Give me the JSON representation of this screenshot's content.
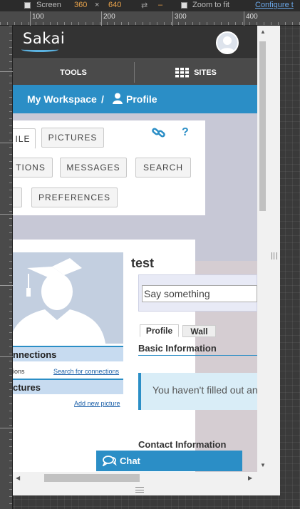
{
  "devtools": {
    "screen_label": "Screen",
    "screen_width": "360",
    "times": "×",
    "screen_height": "640",
    "dash": "–",
    "zoom_label": "Zoom to fit",
    "configure_label": "Configure t"
  },
  "ruler": {
    "ticks": [
      "100",
      "200",
      "300",
      "400"
    ]
  },
  "header": {
    "logo": "Sakai"
  },
  "toolbar": {
    "tools": "TOOLS",
    "sites": "SITES"
  },
  "breadcrumb": {
    "workspace": "My Workspace",
    "separator": "/",
    "profile": "Profile"
  },
  "tools": {
    "profile_tab": "ILE",
    "pictures_tab": "PICTURES",
    "connections": "TIONS",
    "messages": "MESSAGES",
    "search": "SEARCH",
    "preferences": "PREFERENCES"
  },
  "profile": {
    "name": "test",
    "status_placeholder": "Say something",
    "tabs": [
      "Profile",
      "Wall"
    ],
    "basic_info": "Basic Information",
    "notice": "You haven't filled out an",
    "contact_info": "Contact Information"
  },
  "sidebar": {
    "connections_title": "nnections",
    "connections_sub": "ions",
    "search_connections": "Search for connections",
    "pictures_title": "ctures",
    "add_picture": "Add new picture"
  },
  "chat": {
    "label": "Chat"
  },
  "colors": {
    "accent": "#2b8ec6",
    "header": "#333333",
    "toolbar": "#4a4a4a"
  }
}
